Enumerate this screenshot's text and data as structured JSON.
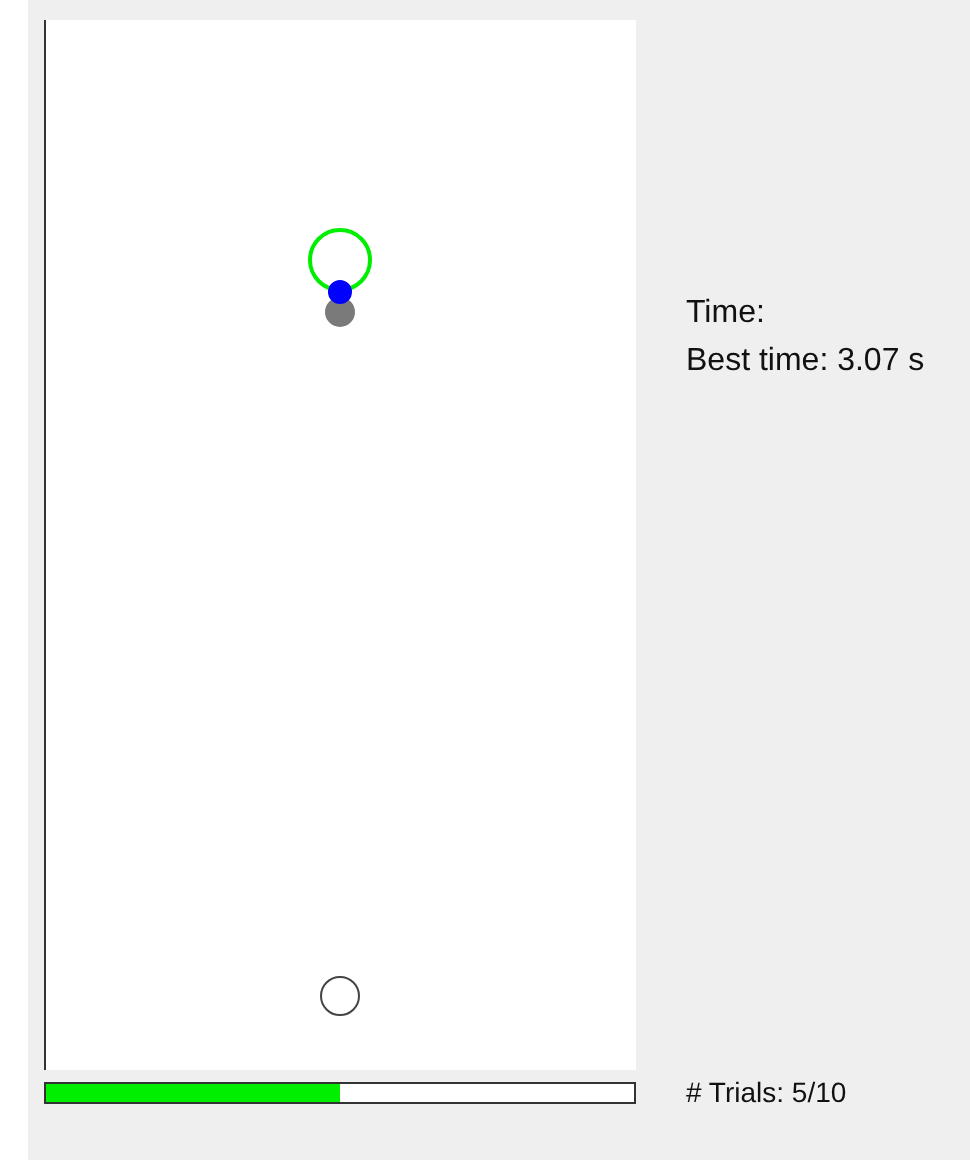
{
  "status": {
    "time_label": "Time:",
    "best_time": "Best time: 3.07 s"
  },
  "progress": {
    "level": 0.5,
    "trials": "# Trials: 5/10"
  }
}
